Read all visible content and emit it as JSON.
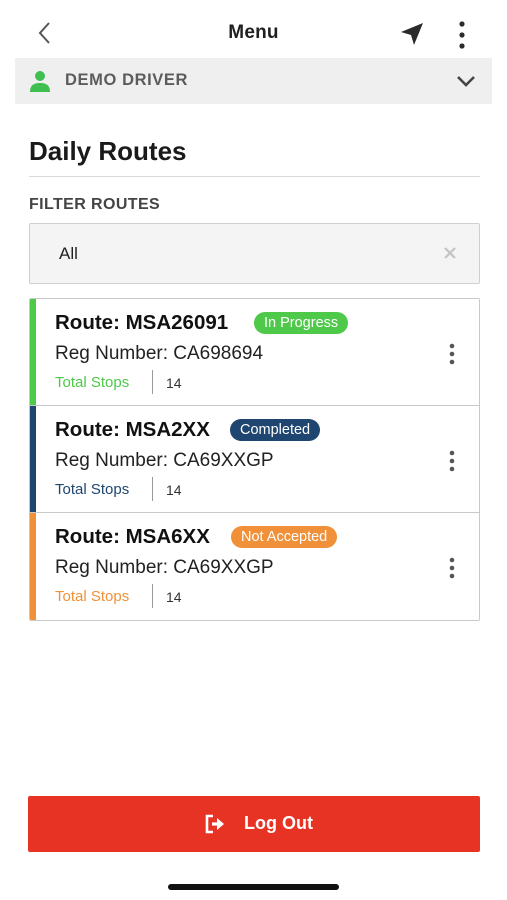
{
  "header": {
    "title": "Menu",
    "icons": {
      "back": "chevron-left-icon",
      "navigation": "location-arrow-icon",
      "more": "more-vertical-icon"
    }
  },
  "driver": {
    "name": "DEMO DRIVER",
    "icon": "person-icon",
    "icon_color": "#3fbf4f"
  },
  "page": {
    "title": "Daily Routes"
  },
  "filter": {
    "label": "FILTER ROUTES",
    "value": "All"
  },
  "routes": [
    {
      "title": "Route: MSA26091",
      "status": "In Progress",
      "reg": "Reg Number: CA698694",
      "stops_label": "Total Stops",
      "stops": "14",
      "color": "#4ec94a"
    },
    {
      "title": "Route: MSA2XX",
      "status": "Completed",
      "reg": "Reg Number: CA69XXGP",
      "stops_label": "Total Stops",
      "stops": "14",
      "color": "#1f4670"
    },
    {
      "title": "Route: MSA6XX",
      "status": "Not Accepted",
      "reg": "Reg Number: CA69XXGP",
      "stops_label": "Total Stops",
      "stops": "14",
      "color": "#f0913a"
    }
  ],
  "logout": {
    "label": "Log Out",
    "icon": "sign-out-icon",
    "color": "#e63323"
  }
}
